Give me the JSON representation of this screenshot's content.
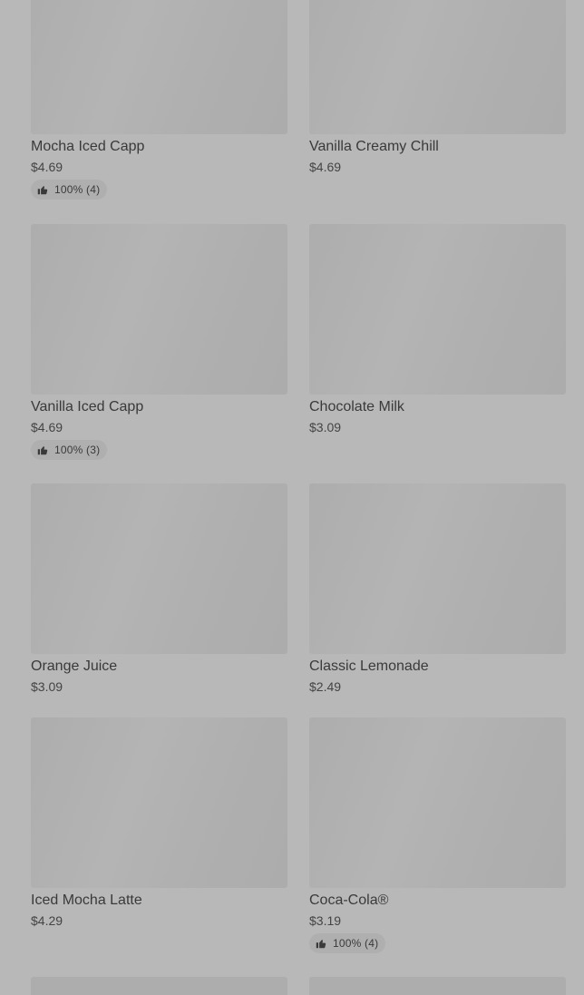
{
  "items": [
    {
      "name": "Mocha Iced Capp",
      "price": "$4.69",
      "rating": "100% (4)"
    },
    {
      "name": "Vanilla Creamy Chill",
      "price": "$4.69",
      "rating": ""
    },
    {
      "name": "Vanilla Iced Capp",
      "price": "$4.69",
      "rating": "100% (3)"
    },
    {
      "name": "Chocolate Milk",
      "price": "$3.09",
      "rating": ""
    },
    {
      "name": "Orange Juice",
      "price": "$3.09",
      "rating": ""
    },
    {
      "name": "Classic Lemonade",
      "price": "$2.49",
      "rating": ""
    },
    {
      "name": "Iced Mocha Latte",
      "price": "$4.29",
      "rating": ""
    },
    {
      "name": "Coca-Cola®",
      "price": "$3.19",
      "rating": "100% (4)"
    }
  ],
  "icons": {
    "rating": "thumbs-up-icon"
  }
}
